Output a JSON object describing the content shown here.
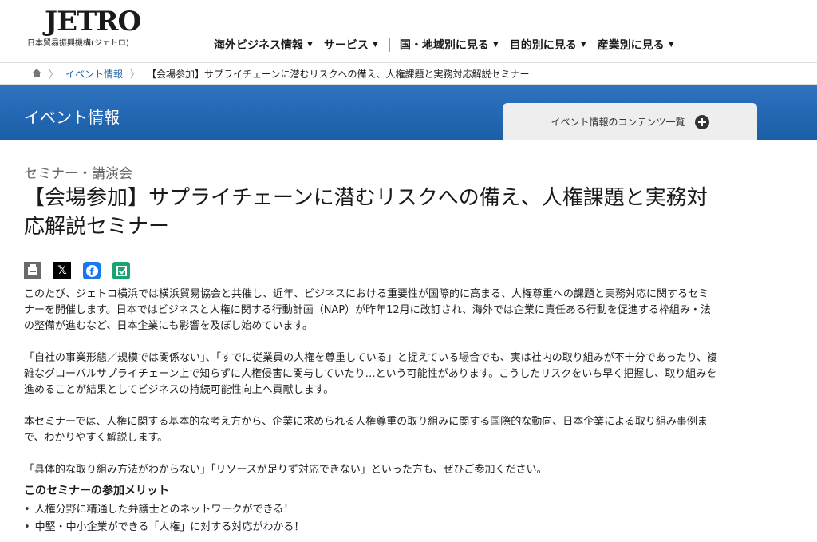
{
  "header": {
    "logo_text": "JETRO",
    "logo_sub": "日本貿易振興機構(ジェトロ)",
    "nav": [
      {
        "label": "海外ビジネス情報"
      },
      {
        "label": "サービス"
      },
      {
        "label": "国・地域別に見る"
      },
      {
        "label": "目的別に見る"
      },
      {
        "label": "産業別に見る"
      }
    ]
  },
  "breadcrumb": {
    "home_icon": "home-icon",
    "link": "イベント情報",
    "current": "【会場参加】サプライチェーンに潜むリスクへの備え、人権課題と実務対応解説セミナー"
  },
  "banner": {
    "title": "イベント情報",
    "tab_label": "イベント情報のコンテンツ一覧",
    "accent": "#1f64a8"
  },
  "article": {
    "category": "セミナー・講演会",
    "title": "【会場参加】サプライチェーンに潜むリスクへの備え、人権課題と実務対応解説セミナー",
    "share": [
      "print-icon",
      "x-icon",
      "facebook-icon",
      "hatena-icon"
    ],
    "paragraphs": [
      "このたび、ジェトロ横浜では横浜貿易協会と共催し、近年、ビジネスにおける重要性が国際的に高まる、人権尊重への課題と実務対応に関するセミナーを開催します。日本ではビジネスと人権に関する行動計画（NAP）が昨年12月に改訂され、海外では企業に責任ある行動を促進する枠組み・法の整備が進むなど、日本企業にも影響を及ぼし始めています。",
      "「自社の事業形態／規模では関係ない」、「すでに従業員の人権を尊重している」と捉えている場合でも、実は社内の取り組みが不十分であったり、複雑なグローバルサプライチェーン上で知らずに人権侵害に関与していたり…という可能性があります。こうしたリスクをいち早く把握し、取り組みを進めることが結果としてビジネスの持続可能性向上へ貢献します。",
      "本セミナーでは、人権に関する基本的な考え方から、企業に求められる人権尊重の取り組みに関する国際的な動向、日本企業による取り組み事例まで、わかりやすく解説します。",
      "「具体的な取り組み方法がわからない」「リソースが足りず対応できない」といった方も、ぜひご参加ください。"
    ],
    "merit_title": "このセミナーの参加メリット",
    "merits": [
      "人権分野に精通した弁護士とのネットワークができる！",
      "中堅・中小企業ができる「人権」に対する対応がわかる！"
    ]
  }
}
